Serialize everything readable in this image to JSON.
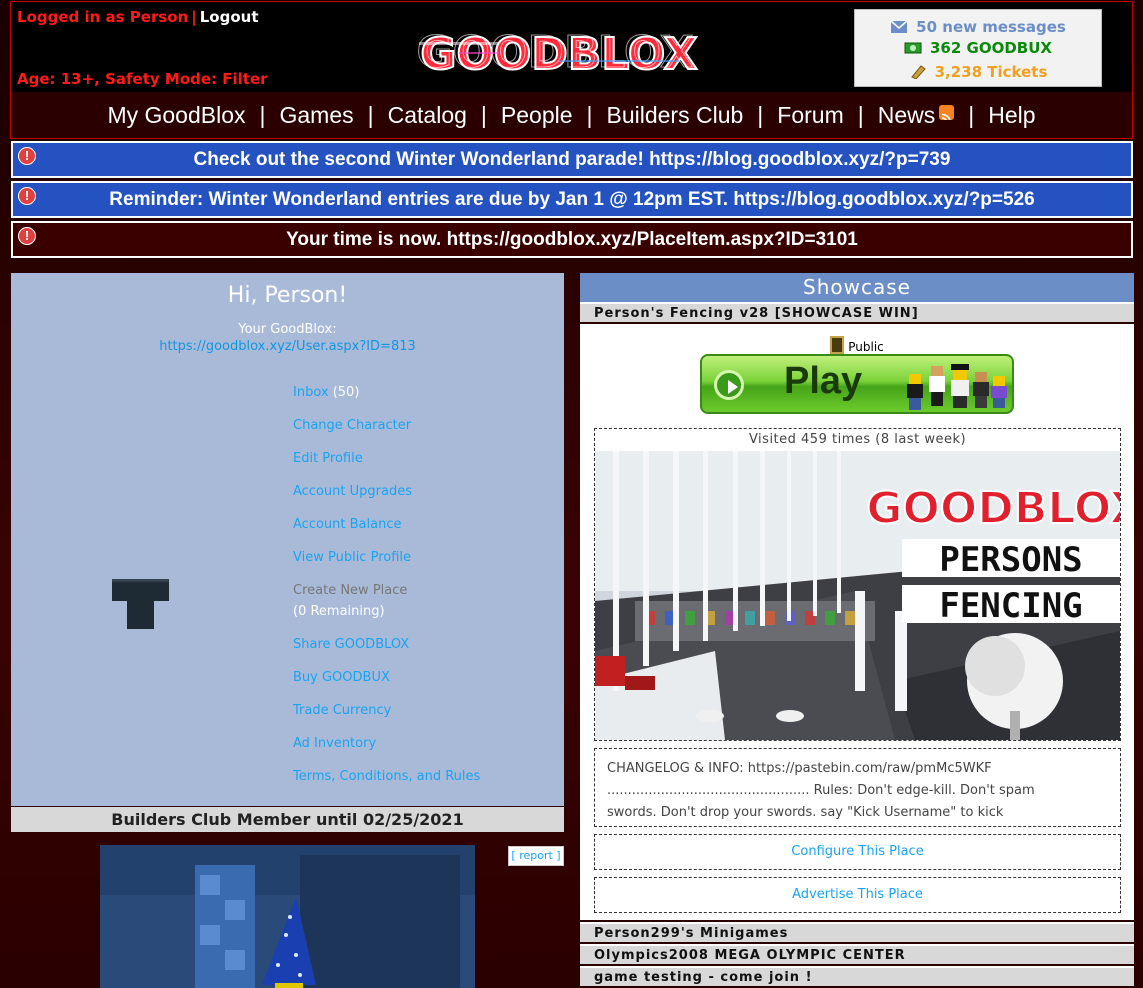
{
  "header": {
    "logged_in_text": "Logged in as Person",
    "separator": "|",
    "logout_label": "Logout",
    "age_text": "Age: 13+, Safety Mode: Filter",
    "logo_text": "GOODBLOX"
  },
  "currency": {
    "messages": "50 new messages",
    "goodbux": "362 GOODBUX",
    "tickets": "3,238 Tickets"
  },
  "nav": {
    "items": [
      "My GoodBlox",
      "Games",
      "Catalog",
      "People",
      "Builders Club",
      "Forum",
      "News",
      "Help"
    ],
    "separator": "|"
  },
  "alerts": [
    {
      "text": "Check out the second Winter Wonderland parade! https://blog.goodblox.xyz/?p=739",
      "style": "blue"
    },
    {
      "text": "Reminder: Winter Wonderland entries are due by Jan 1 @ 12pm EST. https://blog.goodblox.xyz/?p=526",
      "style": "blue"
    },
    {
      "text": "Your time is now. https://goodblox.xyz/PlaceItem.aspx?ID=3101",
      "style": "dark"
    }
  ],
  "profile": {
    "greeting": "Hi, Person!",
    "your_goodblox_label": "Your GoodBlox:",
    "profile_url": "https://goodblox.xyz/User.aspx?ID=813",
    "menu": {
      "inbox": "Inbox",
      "inbox_count": "(50)",
      "change_character": "Change Character",
      "edit_profile": "Edit Profile",
      "account_upgrades": "Account Upgrades",
      "account_balance": "Account Balance",
      "view_public_profile": "View Public Profile",
      "create_new_place": "Create New Place",
      "create_remaining": "(0 Remaining)",
      "share_goodblox": "Share GOODBLOX",
      "buy_goodbux": "Buy GOODBUX",
      "trade_currency": "Trade Currency",
      "ad_inventory": "Ad Inventory",
      "terms": "Terms, Conditions, and Rules"
    },
    "builders_club": "Builders Club Member until 02/25/2021"
  },
  "ad": {
    "report_label": "[ report ]"
  },
  "showcase": {
    "header": "Showcase",
    "places": [
      "Person's Fencing v28 [SHOWCASE WIN]",
      "Person299's Minigames",
      "Olympics2008 MEGA OLYMPIC CENTER",
      "game testing - come join !"
    ],
    "access": "Public",
    "play_label": "Play",
    "visited": "Visited 459 times (8 last week)",
    "thumb_title": "GOODBLOX",
    "thumb_line1": "PERSONS",
    "thumb_line2": "FENCING",
    "changelog_line1": "CHANGELOG & INFO: https://pastebin.com/raw/pmMc5WKF",
    "changelog_line2": "................................................. Rules: Don't edge-kill. Don't spam",
    "changelog_line3": "swords. Don't drop your swords. say \"Kick Username\" to kick",
    "configure_label": "Configure This Place",
    "advertise_label": "Advertise This Place"
  },
  "colors": {
    "accent_red": "#ff1a1a",
    "alert_blue": "#2452c0",
    "panel_blue": "#a9bad9",
    "link_blue": "#1aa3f0",
    "showcase_header": "#6b8ec7"
  }
}
